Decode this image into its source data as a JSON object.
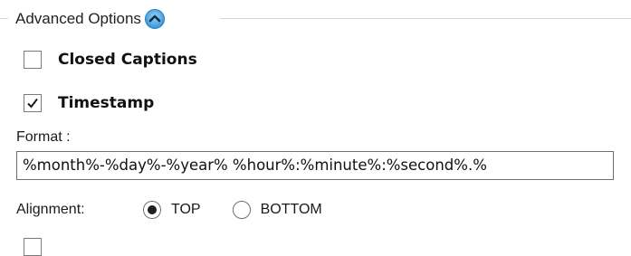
{
  "section": {
    "title": "Advanced Options",
    "collapse_icon": "chevron-up-icon",
    "accent_color": "#4aa3df"
  },
  "closed_captions": {
    "label": "Closed Captions",
    "checked": false
  },
  "timestamp": {
    "label": "Timestamp",
    "checked": true
  },
  "format": {
    "label": "Format :",
    "value": "%month%-%day%-%year% %hour%:%minute%:%second%.%"
  },
  "alignment": {
    "label": "Alignment:",
    "options": [
      {
        "label": "TOP",
        "selected": true
      },
      {
        "label": "BOTTOM",
        "selected": false
      }
    ]
  }
}
